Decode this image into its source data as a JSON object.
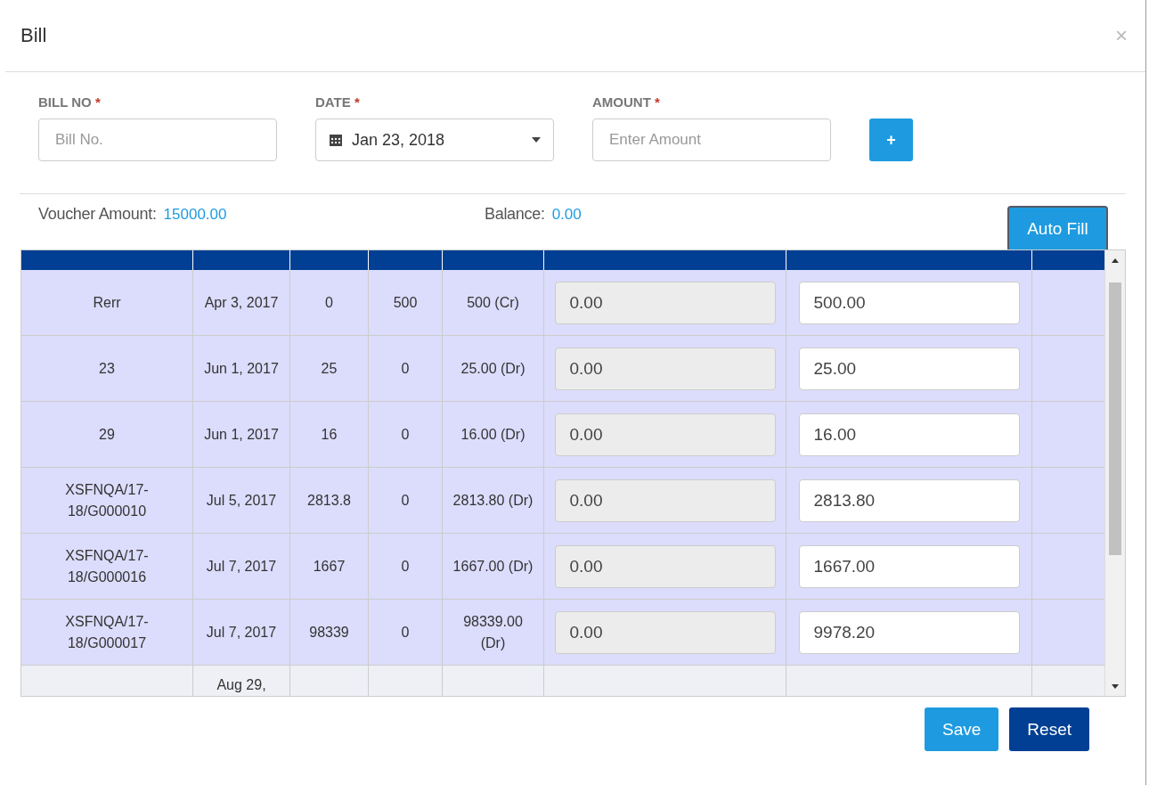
{
  "dialog": {
    "title": "Bill",
    "close": "×"
  },
  "form": {
    "fields": [
      {
        "kind": "text",
        "label": "BILL NO",
        "required_mark": "*",
        "placeholder": "Bill No."
      },
      {
        "kind": "date",
        "label": "DATE",
        "required_mark": "*",
        "value": "Jan 23, 2018"
      },
      {
        "kind": "text",
        "label": "AMOUNT",
        "required_mark": "*",
        "placeholder": "Enter Amount"
      }
    ],
    "add_button": "+"
  },
  "summary": {
    "voucher_label": "Voucher Amount:",
    "voucher_value": "15000.00",
    "balance_label": "Balance:",
    "balance_value": "0.00",
    "auto_fill": "Auto Fill"
  },
  "table": {
    "rows": [
      {
        "highlighted": true,
        "bill_no": "Rerr",
        "bill_date": "Apr 3, 2017",
        "debit": "0",
        "credit": "500",
        "value": "500 (Cr)",
        "debit_input": {
          "value": "0.00",
          "disabled": true
        },
        "credit_input": {
          "value": "500.00",
          "disabled": false
        }
      },
      {
        "highlighted": true,
        "bill_no": "23",
        "bill_date": "Jun 1, 2017",
        "debit": "25",
        "credit": "0",
        "value": "25.00 (Dr)",
        "debit_input": {
          "value": "0.00",
          "disabled": true
        },
        "credit_input": {
          "value": "25.00",
          "disabled": false
        }
      },
      {
        "highlighted": true,
        "bill_no": "29",
        "bill_date": "Jun 1, 2017",
        "debit": "16",
        "credit": "0",
        "value": "16.00 (Dr)",
        "debit_input": {
          "value": "0.00",
          "disabled": true
        },
        "credit_input": {
          "value": "16.00",
          "disabled": false
        }
      },
      {
        "highlighted": true,
        "bill_no": "XSFNQA/17-18/G000010",
        "bill_date": "Jul 5, 2017",
        "debit": "2813.8",
        "credit": "0",
        "value": "2813.80 (Dr)",
        "debit_input": {
          "value": "0.00",
          "disabled": true
        },
        "credit_input": {
          "value": "2813.80",
          "disabled": false
        }
      },
      {
        "highlighted": true,
        "bill_no": "XSFNQA/17-18/G000016",
        "bill_date": "Jul 7, 2017",
        "debit": "1667",
        "credit": "0",
        "value": "1667.00 (Dr)",
        "debit_input": {
          "value": "0.00",
          "disabled": true
        },
        "credit_input": {
          "value": "1667.00",
          "disabled": false
        }
      },
      {
        "highlighted": true,
        "bill_no": "XSFNQA/17-18/G000017",
        "bill_date": "Jul 7, 2017",
        "debit": "98339",
        "credit": "0",
        "value": "98339.00 (Dr)",
        "debit_input": {
          "value": "0.00",
          "disabled": true
        },
        "credit_input": {
          "value": "9978.20",
          "disabled": false
        }
      },
      {
        "highlighted": false,
        "bill_date": "Aug 29,"
      }
    ]
  },
  "buttons": [
    {
      "kind": "primary",
      "label": "Save"
    },
    {
      "kind": "secondary",
      "label": "Reset"
    }
  ]
}
